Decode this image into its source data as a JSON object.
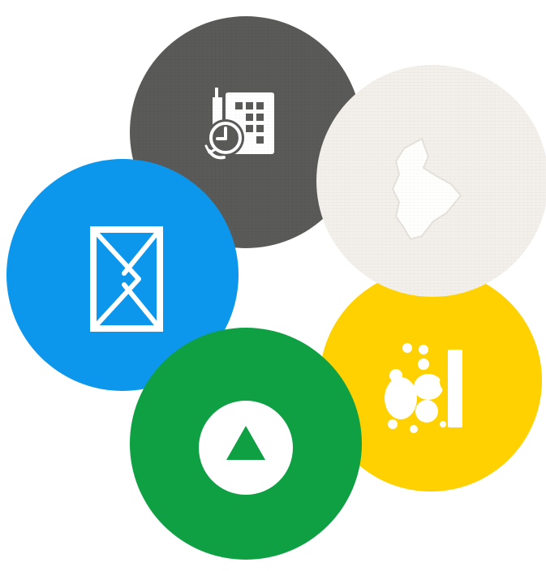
{
  "colors": {
    "dark_gray": "#5a5a59",
    "cream": "#f3f0ec",
    "blue": "#0d97ec",
    "yellow": "#ffd100",
    "green": "#0fa044",
    "icon_white": "#ffffff"
  },
  "circles": [
    {
      "id": "dark",
      "color": "#5a5a59",
      "icon": "calendar-clock-icon"
    },
    {
      "id": "cream",
      "color": "#f3f0ec",
      "icon": "map-region-icon"
    },
    {
      "id": "blue",
      "color": "#0d97ec",
      "icon": "envelope-icon"
    },
    {
      "id": "yellow",
      "color": "#ffd100",
      "icon": "group-people-icon"
    },
    {
      "id": "green",
      "color": "#0fa044",
      "icon": "play-up-triangle-icon"
    }
  ]
}
